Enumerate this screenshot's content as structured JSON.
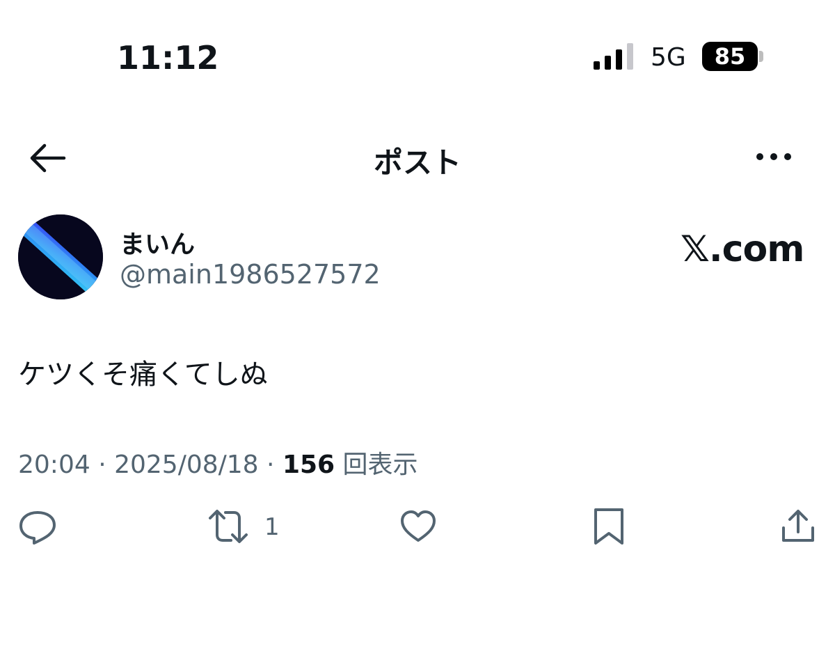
{
  "status_bar": {
    "time": "11:12",
    "network": "5G",
    "battery": "85"
  },
  "header": {
    "title": "ポスト"
  },
  "post": {
    "display_name": "まいん",
    "handle": "@main1986527572",
    "watermark": "𝕏.com",
    "text": "ケツくそ痛くてしぬ",
    "time": "20:04",
    "date": "2025/08/18",
    "views_count": "156",
    "views_label": "回表示",
    "retweet_count": "1"
  },
  "icons": {
    "back": "back-arrow-icon",
    "more": "more-horizontal-icon",
    "reply": "reply-icon",
    "retweet": "retweet-icon",
    "like": "heart-icon",
    "bookmark": "bookmark-icon",
    "share": "share-icon"
  },
  "colors": {
    "text": "#0f1419",
    "secondary": "#536471",
    "avatar_glow": "#2fa8ff"
  }
}
